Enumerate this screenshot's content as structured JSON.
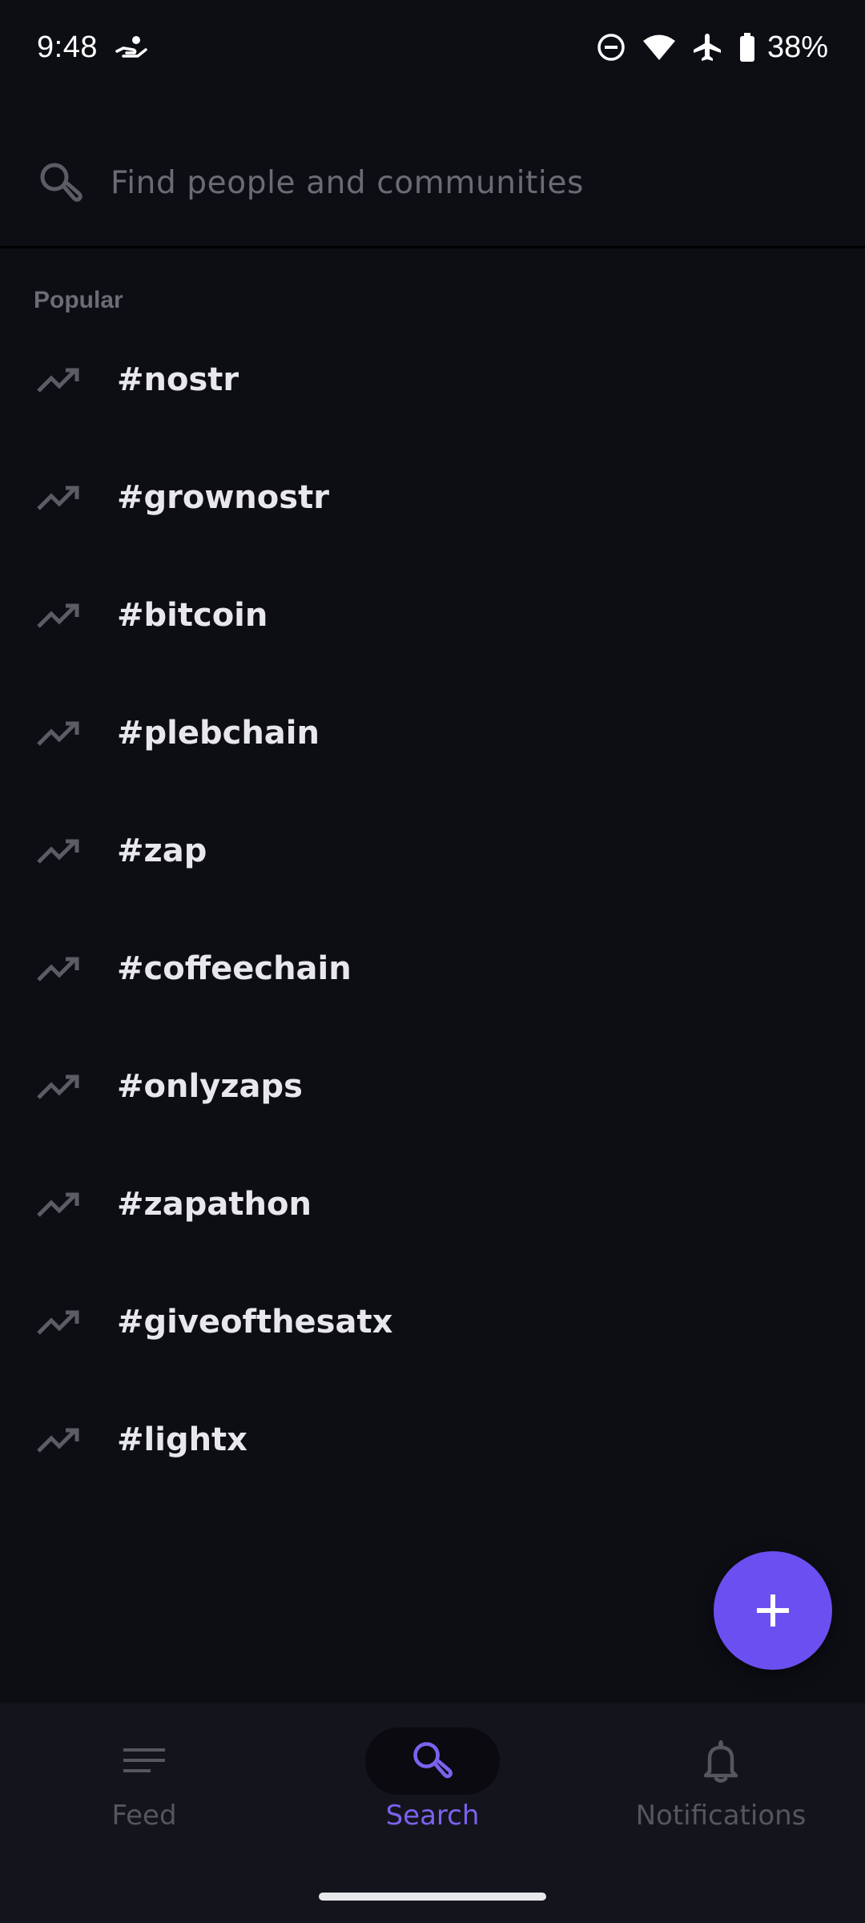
{
  "status_bar": {
    "time": "9:48",
    "battery_percent": "38%",
    "icons": [
      "hand-coin-icon",
      "do-not-disturb-icon",
      "wifi-icon",
      "airplane-icon",
      "battery-icon"
    ]
  },
  "search": {
    "placeholder": "Find people and communities",
    "value": ""
  },
  "popular": {
    "label": "Popular",
    "items": [
      {
        "label": "#nostr"
      },
      {
        "label": "#grownostr"
      },
      {
        "label": "#bitcoin"
      },
      {
        "label": "#plebchain"
      },
      {
        "label": "#zap"
      },
      {
        "label": "#coffeechain"
      },
      {
        "label": "#onlyzaps"
      },
      {
        "label": "#zapathon"
      },
      {
        "label": "#giveofthesatx"
      },
      {
        "label": "#lightx"
      }
    ]
  },
  "fab": {
    "icon": "plus-icon"
  },
  "bottom_nav": {
    "items": [
      {
        "label": "Feed",
        "icon": "feed-icon",
        "active": false
      },
      {
        "label": "Search",
        "icon": "search-icon",
        "active": true
      },
      {
        "label": "Notifications",
        "icon": "bell-icon",
        "active": false
      }
    ]
  },
  "colors": {
    "background": "#0d0e14",
    "accent": "#6c4ff0",
    "nav_active": "#7b62ee",
    "nav_inactive": "#55565e",
    "text_primary": "#e8e8ec",
    "text_muted": "#6b6c74"
  }
}
